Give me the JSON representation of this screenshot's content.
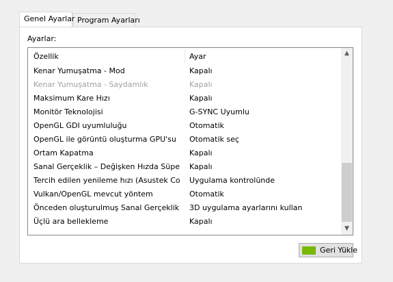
{
  "tabs": [
    {
      "label": "Genel Ayarlar",
      "active": true
    },
    {
      "label": "Program Ayarları",
      "active": false
    }
  ],
  "panel": {
    "settings_label": "Ayarlar:",
    "columns": {
      "feature": "Özellik",
      "setting": "Ayar"
    },
    "rows": [
      {
        "feature": "Kenar Yumuşatma - Mod",
        "setting": "Kapalı",
        "enabled": true
      },
      {
        "feature": "Kenar Yumuşatma - Saydamlık",
        "setting": "Kapalı",
        "enabled": false
      },
      {
        "feature": "Maksimum Kare Hızı",
        "setting": "Kapalı",
        "enabled": true
      },
      {
        "feature": "Monitör Teknolojisi",
        "setting": "G-SYNC Uyumlu",
        "enabled": true
      },
      {
        "feature": "OpenGL GDI uyumluluğu",
        "setting": "Otomatik",
        "enabled": true
      },
      {
        "feature": "OpenGL ile görüntü oluşturma GPU'su",
        "setting": "Otomatik seç",
        "enabled": true
      },
      {
        "feature": "Ortam Kapatma",
        "setting": "Kapalı",
        "enabled": true
      },
      {
        "feature": "Sanal Gerçeklik – Değişken Hızda Süper Ör...",
        "setting": "Kapalı",
        "enabled": true
      },
      {
        "feature": "Tercih edilen yenileme hızı (Asustek Comp...",
        "setting": "Uygulama kontrolünde",
        "enabled": true
      },
      {
        "feature": "Vulkan/OpenGL mevcut yöntem",
        "setting": "Otomatik",
        "enabled": true
      },
      {
        "feature": "Önceden oluşturulmuş Sanal Gerçeklik kar...",
        "setting": "3D uygulama ayarlarını kullan",
        "enabled": true
      },
      {
        "feature": "Üçlü ara bellekleme",
        "setting": "Kapalı",
        "enabled": true
      }
    ]
  },
  "restore_button": {
    "label": "Geri Yükle",
    "icon": "nvidia-logo-icon"
  },
  "colors": {
    "nvidia_green": "#76b900",
    "disabled_text": "#a0a0a0",
    "list_border": "#828790"
  }
}
